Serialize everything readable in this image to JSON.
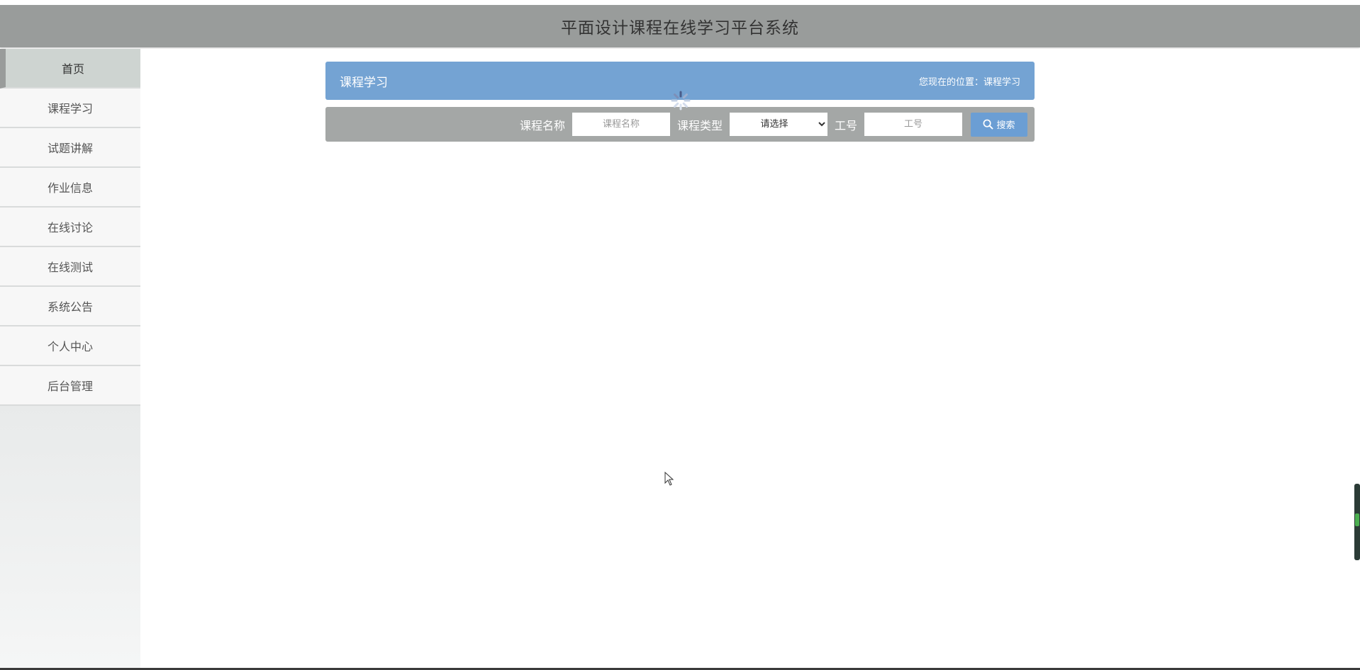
{
  "header": {
    "title": "平面设计课程在线学习平台系统"
  },
  "sidebar": {
    "items": [
      {
        "label": "首页",
        "active": true
      },
      {
        "label": "课程学习"
      },
      {
        "label": "试题讲解"
      },
      {
        "label": "作业信息"
      },
      {
        "label": "在线讨论"
      },
      {
        "label": "在线测试"
      },
      {
        "label": "系统公告"
      },
      {
        "label": "个人中心"
      },
      {
        "label": "后台管理"
      }
    ]
  },
  "titlebar": {
    "title": "课程学习",
    "breadcrumb_prefix": "您现在的位置：",
    "breadcrumb_current": "课程学习"
  },
  "search": {
    "course_name_label": "课程名称",
    "course_name_placeholder": "课程名称",
    "course_type_label": "课程类型",
    "course_type_selected": "请选择",
    "job_no_label": "工号",
    "job_no_placeholder": "工号",
    "button_label": "搜索"
  },
  "icons": {
    "search": "search-icon",
    "loading": "loading-spinner-icon",
    "cursor": "mouse-cursor-icon"
  },
  "colors": {
    "header_bg": "#999c9b",
    "titlebar_bg": "#74a3d3",
    "searchbar_bg": "#a4a7a6",
    "button_bg": "#6b9ed4"
  }
}
